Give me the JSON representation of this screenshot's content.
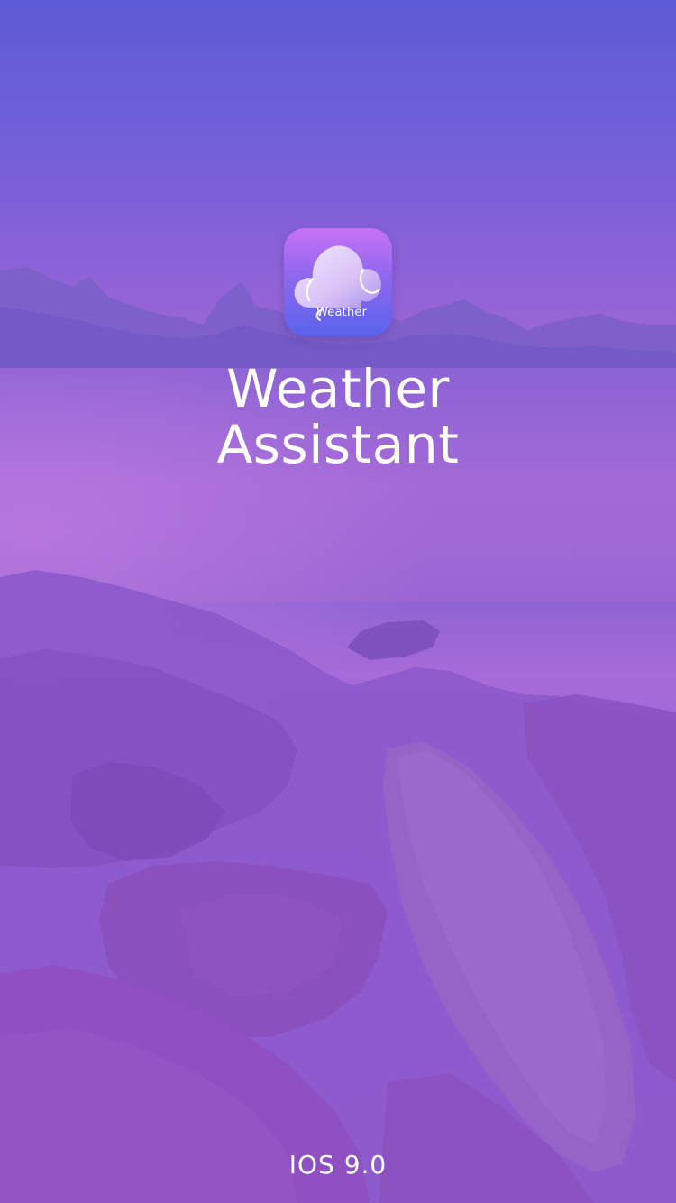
{
  "app": {
    "logo_text": "Weather",
    "title_line1": "Weather",
    "title_line2": "Assistant",
    "version": "IOS 9.0"
  },
  "background": {
    "scene": "purple lake with mountains and foreground rocks"
  },
  "colors": {
    "accent_top": "#c772f5",
    "accent_bottom": "#5a63ec",
    "text": "#ffffff"
  },
  "icons": {
    "logo": "cloud-icon"
  }
}
